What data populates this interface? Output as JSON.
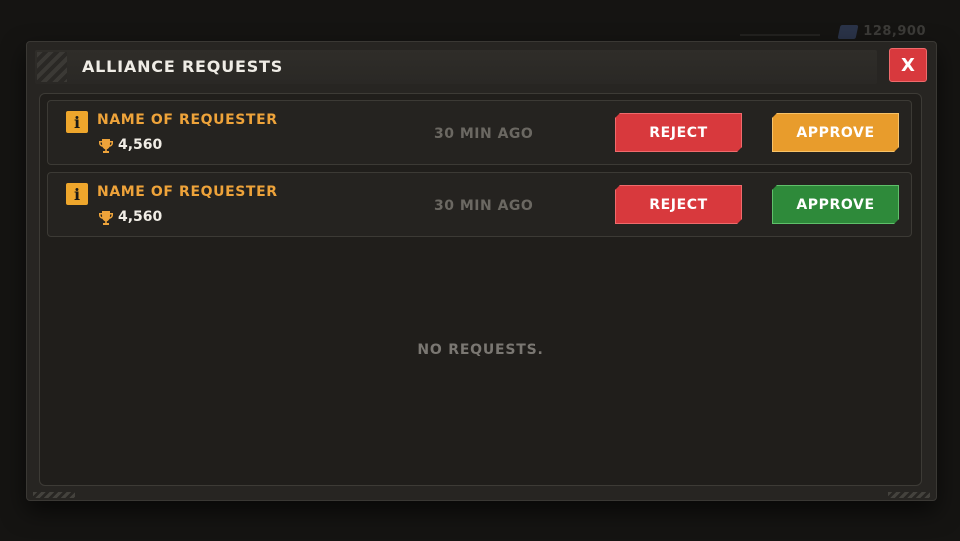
{
  "background": {
    "resource_value": "128,900"
  },
  "modal": {
    "title": "ALLIANCE REQUESTS",
    "close_label": "X",
    "requests": [
      {
        "name": "NAME OF REQUESTER",
        "score": "4,560",
        "time": "30 MIN AGO",
        "reject_label": "REJECT",
        "approve_label": "APPROVE",
        "approve_color": "#e89c2c"
      },
      {
        "name": "NAME OF REQUESTER",
        "score": "4,560",
        "time": "30 MIN AGO",
        "reject_label": "REJECT",
        "approve_label": "APPROVE",
        "approve_color": "#2e8a3a"
      }
    ],
    "empty_message": "NO REQUESTS."
  },
  "colors": {
    "accent": "#eea33a",
    "reject": "#d8393d",
    "approve_orange": "#e89c2c",
    "approve_green": "#2e8a3a"
  },
  "icons": {
    "info": "info-icon",
    "trophy": "trophy-icon",
    "close": "close-icon",
    "gem": "gem-icon"
  }
}
